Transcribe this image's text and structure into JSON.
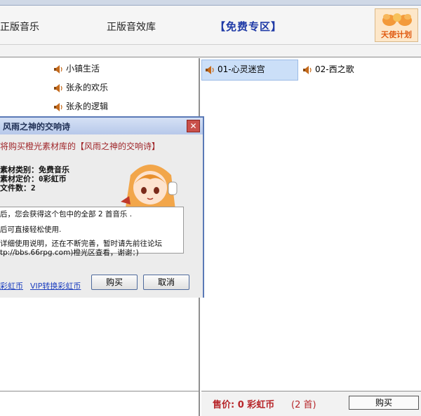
{
  "header": {
    "tab1": "正版音乐",
    "tab2": "正版音效库",
    "tab3": "【免费专区】",
    "logo_text": "天使计划"
  },
  "tree": {
    "items": [
      "小镇生活",
      "张永的欢乐",
      "张永的逻辑"
    ]
  },
  "files": {
    "items": [
      "01-心灵迷宫",
      "02-西之歌"
    ]
  },
  "footer": {
    "price": "售价: 0 彩虹币",
    "count": "(2 首)",
    "buy": "购买"
  },
  "dialog": {
    "title": "风雨之神的交响诗",
    "heading": "将购买橙光素材库的【风雨之神的交响诗】",
    "info_type": "素材类别：免费音乐",
    "info_price": "素材定价：0彩虹币",
    "info_count": "文件数：2",
    "desc1": "后，您会获得这个包中的全部 2 首音乐 .",
    "desc2": "后可直接轻松使用.",
    "desc3": "详细使用说明，还在不断完善，暂时请先前往论坛",
    "desc4": "tp://bbs.66rpg.com)橙光区查看，谢谢：)",
    "link1": "彩虹币",
    "link2": "VIP转换彩虹币",
    "buy": "购买",
    "cancel": "取消"
  },
  "colors": {
    "title_accent": "#1f3aa6",
    "price_red": "#b7262a",
    "selection": "#cbdff8",
    "dialog_border": "#5a79b6"
  },
  "icons": [
    "speaker-icon",
    "close-icon",
    "logo-wings-icon",
    "mascot-image"
  ]
}
